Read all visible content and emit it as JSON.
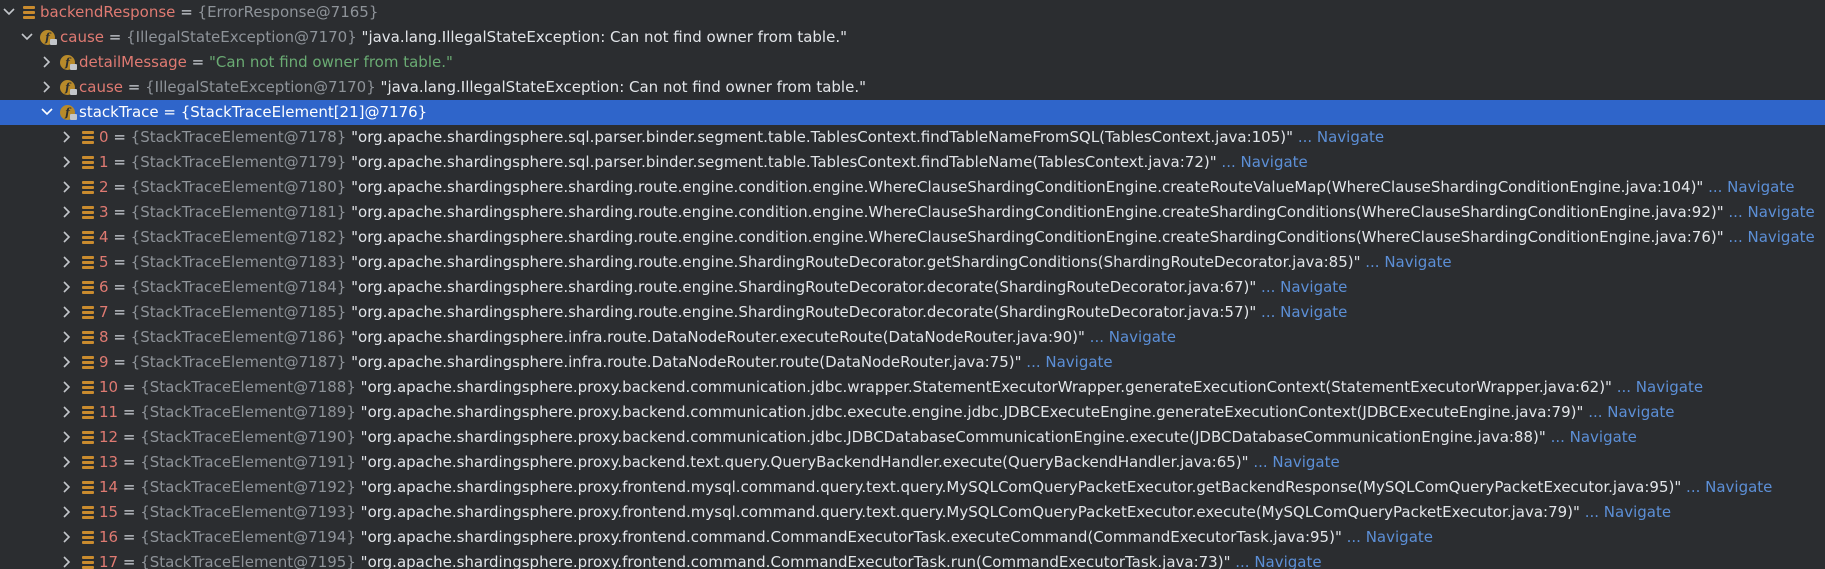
{
  "root": {
    "name": "backendResponse",
    "value": "{ErrorResponse@7165}"
  },
  "cause": {
    "name": "cause",
    "value": "{IllegalStateException@7170}",
    "text": "\"java.lang.IllegalStateException: Can not find owner from table.\""
  },
  "detail": {
    "name": "detailMessage",
    "value": "\"Can not find owner from table.\""
  },
  "cause2": {
    "name": "cause",
    "value": "{IllegalStateException@7170}",
    "text": "\"java.lang.IllegalStateException: Can not find owner from table.\""
  },
  "stack": {
    "name": "stackTrace",
    "value": "{StackTraceElement[21]@7176}"
  },
  "field_icon": "f",
  "navigate_label": "... Navigate",
  "frames": [
    {
      "index": "0",
      "ref": "{StackTraceElement@7178}",
      "text": "\"org.apache.shardingsphere.sql.parser.binder.segment.table.TablesContext.findTableNameFromSQL(TablesContext.java:105)\""
    },
    {
      "index": "1",
      "ref": "{StackTraceElement@7179}",
      "text": "\"org.apache.shardingsphere.sql.parser.binder.segment.table.TablesContext.findTableName(TablesContext.java:72)\""
    },
    {
      "index": "2",
      "ref": "{StackTraceElement@7180}",
      "text": "\"org.apache.shardingsphere.sharding.route.engine.condition.engine.WhereClauseShardingConditionEngine.createRouteValueMap(WhereClauseShardingConditionEngine.java:104)\""
    },
    {
      "index": "3",
      "ref": "{StackTraceElement@7181}",
      "text": "\"org.apache.shardingsphere.sharding.route.engine.condition.engine.WhereClauseShardingConditionEngine.createShardingConditions(WhereClauseShardingConditionEngine.java:92)\""
    },
    {
      "index": "4",
      "ref": "{StackTraceElement@7182}",
      "text": "\"org.apache.shardingsphere.sharding.route.engine.condition.engine.WhereClauseShardingConditionEngine.createShardingConditions(WhereClauseShardingConditionEngine.java:76)\""
    },
    {
      "index": "5",
      "ref": "{StackTraceElement@7183}",
      "text": "\"org.apache.shardingsphere.sharding.route.engine.ShardingRouteDecorator.getShardingConditions(ShardingRouteDecorator.java:85)\""
    },
    {
      "index": "6",
      "ref": "{StackTraceElement@7184}",
      "text": "\"org.apache.shardingsphere.sharding.route.engine.ShardingRouteDecorator.decorate(ShardingRouteDecorator.java:67)\""
    },
    {
      "index": "7",
      "ref": "{StackTraceElement@7185}",
      "text": "\"org.apache.shardingsphere.sharding.route.engine.ShardingRouteDecorator.decorate(ShardingRouteDecorator.java:57)\""
    },
    {
      "index": "8",
      "ref": "{StackTraceElement@7186}",
      "text": "\"org.apache.shardingsphere.infra.route.DataNodeRouter.executeRoute(DataNodeRouter.java:90)\""
    },
    {
      "index": "9",
      "ref": "{StackTraceElement@7187}",
      "text": "\"org.apache.shardingsphere.infra.route.DataNodeRouter.route(DataNodeRouter.java:75)\""
    },
    {
      "index": "10",
      "ref": "{StackTraceElement@7188}",
      "text": "\"org.apache.shardingsphere.proxy.backend.communication.jdbc.wrapper.StatementExecutorWrapper.generateExecutionContext(StatementExecutorWrapper.java:62)\""
    },
    {
      "index": "11",
      "ref": "{StackTraceElement@7189}",
      "text": "\"org.apache.shardingsphere.proxy.backend.communication.jdbc.execute.engine.jdbc.JDBCExecuteEngine.generateExecutionContext(JDBCExecuteEngine.java:79)\""
    },
    {
      "index": "12",
      "ref": "{StackTraceElement@7190}",
      "text": "\"org.apache.shardingsphere.proxy.backend.communication.jdbc.JDBCDatabaseCommunicationEngine.execute(JDBCDatabaseCommunicationEngine.java:88)\""
    },
    {
      "index": "13",
      "ref": "{StackTraceElement@7191}",
      "text": "\"org.apache.shardingsphere.proxy.backend.text.query.QueryBackendHandler.execute(QueryBackendHandler.java:65)\""
    },
    {
      "index": "14",
      "ref": "{StackTraceElement@7192}",
      "text": "\"org.apache.shardingsphere.proxy.frontend.mysql.command.query.text.query.MySQLComQueryPacketExecutor.getBackendResponse(MySQLComQueryPacketExecutor.java:95)\""
    },
    {
      "index": "15",
      "ref": "{StackTraceElement@7193}",
      "text": "\"org.apache.shardingsphere.proxy.frontend.mysql.command.query.text.query.MySQLComQueryPacketExecutor.execute(MySQLComQueryPacketExecutor.java:79)\""
    },
    {
      "index": "16",
      "ref": "{StackTraceElement@7194}",
      "text": "\"org.apache.shardingsphere.proxy.frontend.command.CommandExecutorTask.executeCommand(CommandExecutorTask.java:95)\""
    },
    {
      "index": "17",
      "ref": "{StackTraceElement@7195}",
      "text": "\"org.apache.shardingsphere.proxy.frontend.command.CommandExecutorTask.run(CommandExecutorTask.java:73)\""
    }
  ]
}
